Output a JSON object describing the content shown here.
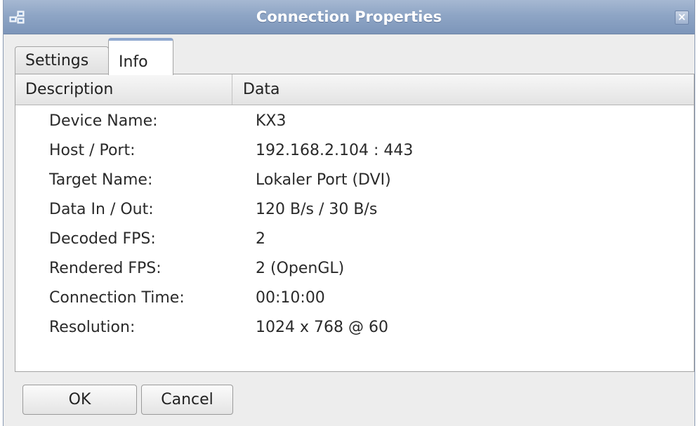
{
  "window": {
    "title": "Connection Properties",
    "close_label": "×"
  },
  "tabs": [
    {
      "label": "Settings"
    },
    {
      "label": "Info"
    }
  ],
  "table": {
    "columns": [
      "Description",
      "Data"
    ],
    "rows": [
      {
        "key": "Device Name:",
        "value": "KX3"
      },
      {
        "key": "Host / Port:",
        "value": "192.168.2.104 : 443"
      },
      {
        "key": "Target Name:",
        "value": "Lokaler Port (DVI)"
      },
      {
        "key": "Data In / Out:",
        "value": "120 B/s / 30 B/s"
      },
      {
        "key": "Decoded FPS:",
        "value": "2"
      },
      {
        "key": "Rendered FPS:",
        "value": "2 (OpenGL)"
      },
      {
        "key": "Connection Time:",
        "value": "00:10:00"
      },
      {
        "key": "Resolution:",
        "value": "1024 x 768 @ 60"
      }
    ]
  },
  "buttons": {
    "ok": "OK",
    "cancel": "Cancel"
  },
  "icons": {
    "title_icon": "network-computers-icon",
    "close_icon": "close-icon"
  },
  "colors": {
    "titlebar": "#8ea5c5",
    "active_tab_accent": "#8fa8cf"
  }
}
